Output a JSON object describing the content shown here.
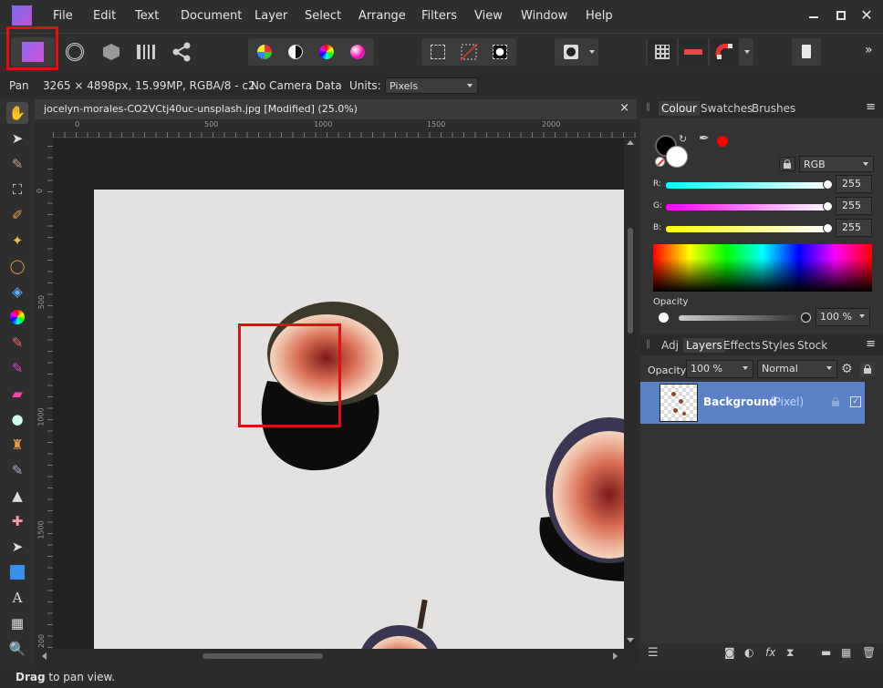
{
  "menu": {
    "items": [
      "File",
      "Edit",
      "Text",
      "Document",
      "Layer",
      "Select",
      "Arrange",
      "Filters",
      "View",
      "Window",
      "Help"
    ]
  },
  "window": {
    "minimize_icon": "minimize-icon",
    "maximize_icon": "maximize-icon",
    "close_icon": "close-icon"
  },
  "toolbar": {
    "overflow_label": "»"
  },
  "context": {
    "tool": "Pan",
    "image_info": "3265 × 4898px, 15.99MP, RGBA/8 - c2",
    "camera": "No Camera Data",
    "units_label": "Units:",
    "units_value": "Pixels"
  },
  "document": {
    "tab_title": "jocelyn-morales-CO2VCtj40uc-unsplash.jpg [Modified] (25.0%)",
    "close_label": "×",
    "ruler_unit": "px",
    "ruler_h_labels": [
      "0",
      "500",
      "1000",
      "1500",
      "2000"
    ],
    "ruler_v_labels": [
      "0",
      "500",
      "1000",
      "1500",
      "200"
    ]
  },
  "colour_panel": {
    "tabs": [
      "Colour",
      "Swatches",
      "Brushes"
    ],
    "active_tab": "Colour",
    "model": "RGB",
    "r_label": "R:",
    "r_value": "255",
    "g_label": "G:",
    "g_value": "255",
    "b_label": "B:",
    "b_value": "255",
    "opacity_label": "Opacity",
    "opacity_value": "100 %",
    "primary_color": "#000000",
    "secondary_color": "#ffffff",
    "picker_color": "#ff0000"
  },
  "layers_panel": {
    "tabs": [
      "Adj",
      "Layers",
      "Effects",
      "Styles",
      "Stock"
    ],
    "active_tab": "Layers",
    "opacity_label": "Opacity:",
    "opacity_value": "100 %",
    "blend_mode": "Normal",
    "layers": [
      {
        "name": "Background",
        "type": "(Pixel)"
      }
    ]
  },
  "status": {
    "bold": "Drag",
    "text": "to pan view."
  },
  "colors": {
    "accent_highlight": "#e01010",
    "layer_selected": "#5b82c7"
  }
}
